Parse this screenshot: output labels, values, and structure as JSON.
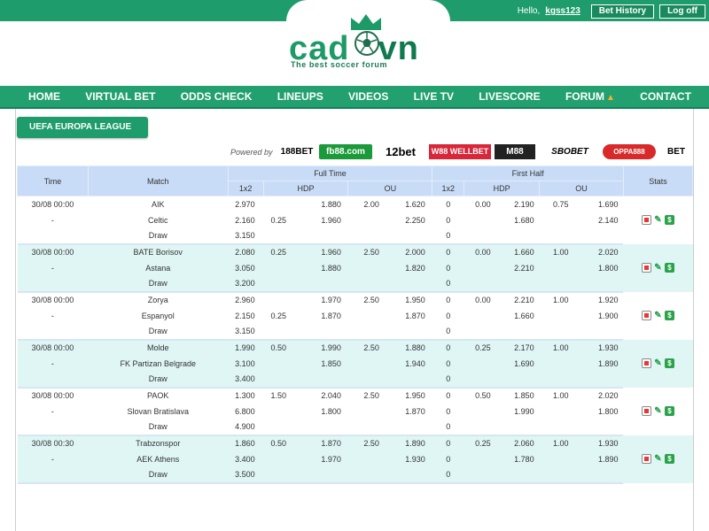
{
  "header": {
    "greeting": "Hello,",
    "username": "kgss123",
    "bet_history": "Bet History",
    "logout": "Log off",
    "logo_text_1": "cad",
    "logo_text_2": "vn",
    "tagline": "The best soccer forum"
  },
  "nav": {
    "items": [
      "HOME",
      "VIRTUAL BET",
      "ODDS CHECK",
      "LINEUPS",
      "VIDEOS",
      "LIVE TV",
      "LIVESCORE",
      "FORUM",
      "CONTACT"
    ]
  },
  "league": "UEFA EUROPA LEAGUE",
  "powered_by": "Powered by",
  "brands": [
    {
      "name": "188BET",
      "color": "#f26522"
    },
    {
      "name": "fb88.com",
      "color": "#1a9a3a"
    },
    {
      "name": "12bet",
      "color": "#111111"
    },
    {
      "name": "W88 WELLBET",
      "color": "#d8263a"
    },
    {
      "name": "M88",
      "color": "#222222"
    },
    {
      "name": "SBOBET",
      "color": "#1b3d8f"
    },
    {
      "name": "OPPA888",
      "color": "#d82a2a"
    },
    {
      "name": "BET",
      "color": "#f0a020"
    }
  ],
  "table": {
    "headers": {
      "time": "Time",
      "match": "Match",
      "full_time": "Full Time",
      "first_half": "First Half",
      "stats": "Stats",
      "x12": "1x2",
      "hdp": "HDP",
      "ou": "OU"
    },
    "matches": [
      {
        "time": "30/08 00:00",
        "dash": "-",
        "rows": [
          {
            "team": "AIK",
            "ft_1x2": "2.970",
            "ft_hdp_line": "",
            "ft_hdp_odds": "1.880",
            "ft_ou_line": "2.00",
            "ft_ou_odds": "1.620",
            "fh_1x2": "0",
            "fh_hdp_line": "0.00",
            "fh_hdp_odds": "2.190",
            "fh_ou_line": "0.75",
            "fh_ou_odds": "1.690"
          },
          {
            "team": "Celtic",
            "ft_1x2": "2.160",
            "ft_hdp_line": "0.25",
            "ft_hdp_odds": "1.960",
            "ft_ou_line": "",
            "ft_ou_odds": "2.250",
            "fh_1x2": "0",
            "fh_hdp_line": "",
            "fh_hdp_odds": "1.680",
            "fh_ou_line": "",
            "fh_ou_odds": "2.140"
          },
          {
            "team": "Draw",
            "ft_1x2": "3.150",
            "ft_hdp_line": "",
            "ft_hdp_odds": "",
            "ft_ou_line": "",
            "ft_ou_odds": "",
            "fh_1x2": "0",
            "fh_hdp_line": "",
            "fh_hdp_odds": "",
            "fh_ou_line": "",
            "fh_ou_odds": ""
          }
        ]
      },
      {
        "time": "30/08 00:00",
        "dash": "-",
        "rows": [
          {
            "team": "BATE Borisov",
            "ft_1x2": "2.080",
            "ft_hdp_line": "0.25",
            "ft_hdp_odds": "1.960",
            "ft_ou_line": "2.50",
            "ft_ou_odds": "2.000",
            "fh_1x2": "0",
            "fh_hdp_line": "0.00",
            "fh_hdp_odds": "1.660",
            "fh_ou_line": "1.00",
            "fh_ou_odds": "2.020"
          },
          {
            "team": "Astana",
            "ft_1x2": "3.050",
            "ft_hdp_line": "",
            "ft_hdp_odds": "1.880",
            "ft_ou_line": "",
            "ft_ou_odds": "1.820",
            "fh_1x2": "0",
            "fh_hdp_line": "",
            "fh_hdp_odds": "2.210",
            "fh_ou_line": "",
            "fh_ou_odds": "1.800"
          },
          {
            "team": "Draw",
            "ft_1x2": "3.200",
            "ft_hdp_line": "",
            "ft_hdp_odds": "",
            "ft_ou_line": "",
            "ft_ou_odds": "",
            "fh_1x2": "0",
            "fh_hdp_line": "",
            "fh_hdp_odds": "",
            "fh_ou_line": "",
            "fh_ou_odds": ""
          }
        ]
      },
      {
        "time": "30/08 00:00",
        "dash": "-",
        "rows": [
          {
            "team": "Zorya",
            "ft_1x2": "2.960",
            "ft_hdp_line": "",
            "ft_hdp_odds": "1.970",
            "ft_ou_line": "2.50",
            "ft_ou_odds": "1.950",
            "fh_1x2": "0",
            "fh_hdp_line": "0.00",
            "fh_hdp_odds": "2.210",
            "fh_ou_line": "1.00",
            "fh_ou_odds": "1.920"
          },
          {
            "team": "Espanyol",
            "ft_1x2": "2.150",
            "ft_hdp_line": "0.25",
            "ft_hdp_odds": "1.870",
            "ft_ou_line": "",
            "ft_ou_odds": "1.870",
            "fh_1x2": "0",
            "fh_hdp_line": "",
            "fh_hdp_odds": "1.660",
            "fh_ou_line": "",
            "fh_ou_odds": "1.900"
          },
          {
            "team": "Draw",
            "ft_1x2": "3.150",
            "ft_hdp_line": "",
            "ft_hdp_odds": "",
            "ft_ou_line": "",
            "ft_ou_odds": "",
            "fh_1x2": "0",
            "fh_hdp_line": "",
            "fh_hdp_odds": "",
            "fh_ou_line": "",
            "fh_ou_odds": ""
          }
        ]
      },
      {
        "time": "30/08 00:00",
        "dash": "-",
        "rows": [
          {
            "team": "Molde",
            "ft_1x2": "1.990",
            "ft_hdp_line": "0.50",
            "ft_hdp_odds": "1.990",
            "ft_ou_line": "2.50",
            "ft_ou_odds": "1.880",
            "fh_1x2": "0",
            "fh_hdp_line": "0.25",
            "fh_hdp_odds": "2.170",
            "fh_ou_line": "1.00",
            "fh_ou_odds": "1.930"
          },
          {
            "team": "FK Partizan Belgrade",
            "ft_1x2": "3.100",
            "ft_hdp_line": "",
            "ft_hdp_odds": "1.850",
            "ft_ou_line": "",
            "ft_ou_odds": "1.940",
            "fh_1x2": "0",
            "fh_hdp_line": "",
            "fh_hdp_odds": "1.690",
            "fh_ou_line": "",
            "fh_ou_odds": "1.890"
          },
          {
            "team": "Draw",
            "ft_1x2": "3.400",
            "ft_hdp_line": "",
            "ft_hdp_odds": "",
            "ft_ou_line": "",
            "ft_ou_odds": "",
            "fh_1x2": "0",
            "fh_hdp_line": "",
            "fh_hdp_odds": "",
            "fh_ou_line": "",
            "fh_ou_odds": ""
          }
        ]
      },
      {
        "time": "30/08 00:00",
        "dash": "-",
        "rows": [
          {
            "team": "PAOK",
            "ft_1x2": "1.300",
            "ft_hdp_line": "1.50",
            "ft_hdp_odds": "2.040",
            "ft_ou_line": "2.50",
            "ft_ou_odds": "1.950",
            "fh_1x2": "0",
            "fh_hdp_line": "0.50",
            "fh_hdp_odds": "1.850",
            "fh_ou_line": "1.00",
            "fh_ou_odds": "2.020"
          },
          {
            "team": "Slovan Bratislava",
            "ft_1x2": "6.800",
            "ft_hdp_line": "",
            "ft_hdp_odds": "1.800",
            "ft_ou_line": "",
            "ft_ou_odds": "1.870",
            "fh_1x2": "0",
            "fh_hdp_line": "",
            "fh_hdp_odds": "1.990",
            "fh_ou_line": "",
            "fh_ou_odds": "1.800"
          },
          {
            "team": "Draw",
            "ft_1x2": "4.900",
            "ft_hdp_line": "",
            "ft_hdp_odds": "",
            "ft_ou_line": "",
            "ft_ou_odds": "",
            "fh_1x2": "0",
            "fh_hdp_line": "",
            "fh_hdp_odds": "",
            "fh_ou_line": "",
            "fh_ou_odds": ""
          }
        ]
      },
      {
        "time": "30/08 00:30",
        "dash": "-",
        "rows": [
          {
            "team": "Trabzonspor",
            "ft_1x2": "1.860",
            "ft_hdp_line": "0.50",
            "ft_hdp_odds": "1.870",
            "ft_ou_line": "2.50",
            "ft_ou_odds": "1.890",
            "fh_1x2": "0",
            "fh_hdp_line": "0.25",
            "fh_hdp_odds": "2.060",
            "fh_ou_line": "1.00",
            "fh_ou_odds": "1.930"
          },
          {
            "team": "AEK Athens",
            "ft_1x2": "3.400",
            "ft_hdp_line": "",
            "ft_hdp_odds": "1.970",
            "ft_ou_line": "",
            "ft_ou_odds": "1.930",
            "fh_1x2": "0",
            "fh_hdp_line": "",
            "fh_hdp_odds": "1.780",
            "fh_ou_line": "",
            "fh_ou_odds": "1.890"
          },
          {
            "team": "Draw",
            "ft_1x2": "3.500",
            "ft_hdp_line": "",
            "ft_hdp_odds": "",
            "ft_ou_line": "",
            "ft_ou_odds": "",
            "fh_1x2": "0",
            "fh_hdp_line": "",
            "fh_hdp_odds": "",
            "fh_ou_line": "",
            "fh_ou_odds": ""
          }
        ]
      }
    ]
  }
}
